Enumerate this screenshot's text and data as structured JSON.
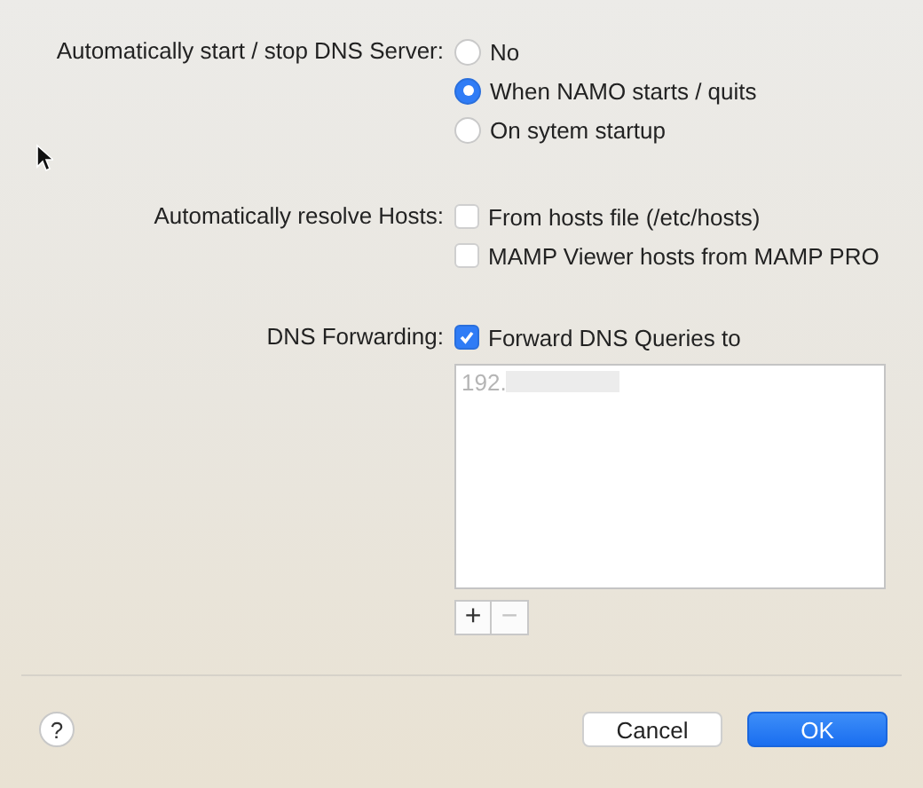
{
  "start_stop": {
    "label": "Automatically start / stop DNS Server:",
    "options": [
      {
        "label": "No",
        "selected": false
      },
      {
        "label": "When NAMO starts / quits",
        "selected": true
      },
      {
        "label": "On sytem startup",
        "selected": false
      }
    ]
  },
  "resolve_hosts": {
    "label": "Automatically resolve Hosts:",
    "options": [
      {
        "label": "From hosts file (/etc/hosts)",
        "checked": false
      },
      {
        "label": "MAMP Viewer hosts from MAMP PRO",
        "checked": false
      }
    ]
  },
  "forwarding": {
    "label": "DNS Forwarding:",
    "checkbox": {
      "label": "Forward DNS Queries to",
      "checked": true
    },
    "servers": [
      {
        "address": "192."
      }
    ],
    "add_button": {
      "label": "+",
      "disabled": false
    },
    "remove_button": {
      "label": "−",
      "disabled": true
    }
  },
  "help_button": "?",
  "buttons": [
    {
      "label": "Cancel",
      "kind": "default"
    },
    {
      "label": "OK",
      "kind": "primary"
    }
  ]
}
